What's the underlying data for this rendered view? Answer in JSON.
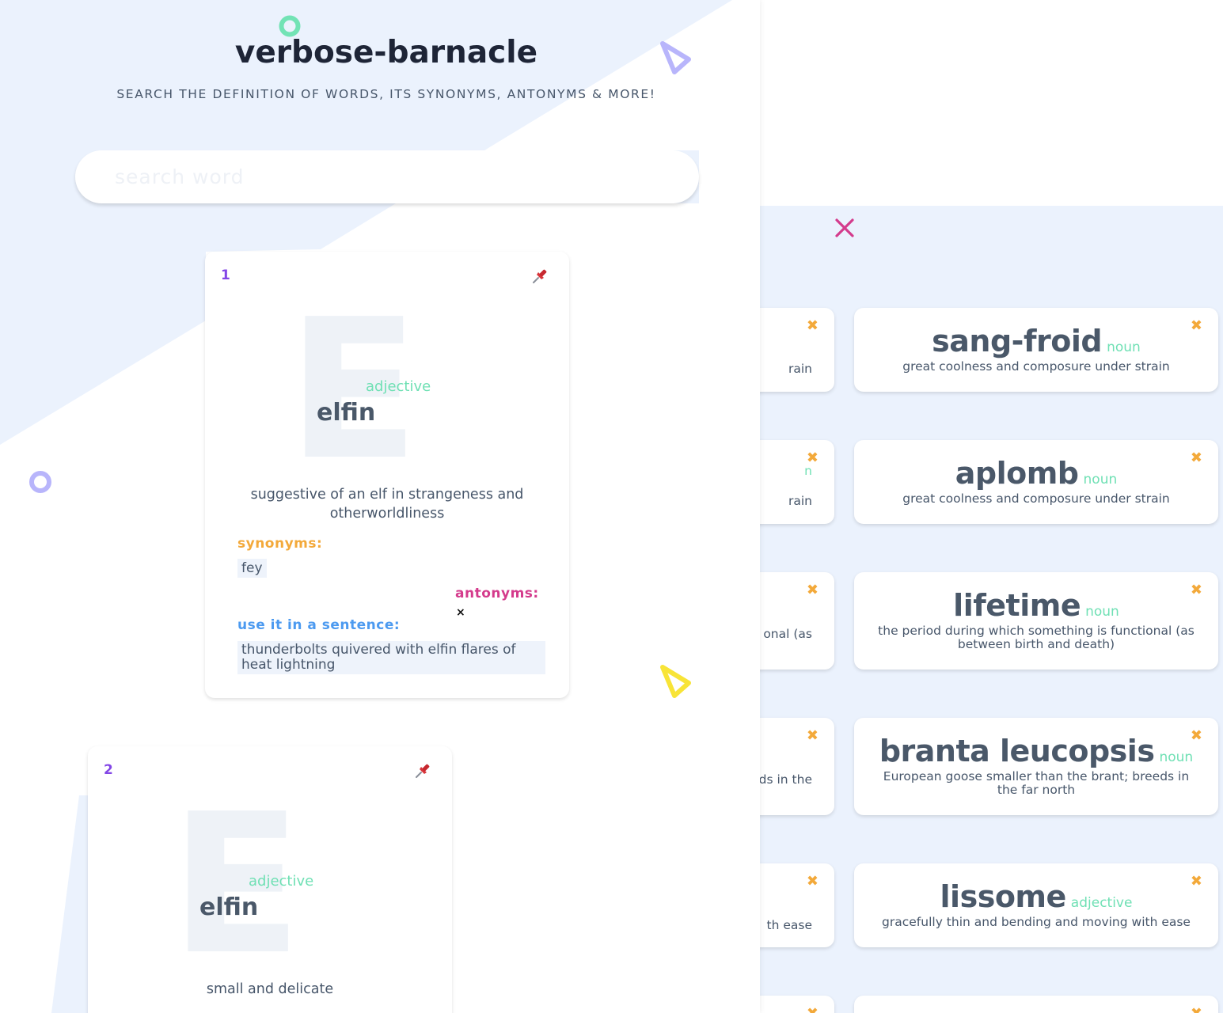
{
  "app": {
    "title": "verbose-barnacle",
    "subtitle": "SEARCH THE DEFINITION OF WORDS, ITS SYNONYMS, ANTONYMS & MORE!"
  },
  "search": {
    "placeholder": "search word",
    "value": ""
  },
  "colors": {
    "accent_purple": "#8346e6",
    "synonyms": "#f3a93a",
    "antonyms": "#d43b8c",
    "sentence": "#4c9af0",
    "part_of_speech": "#6fe0b4",
    "panel_bg": "#ebf2fd"
  },
  "labels": {
    "synonyms": "synonyms:",
    "antonyms": "antonyms:",
    "sentence": "use it in a sentence:"
  },
  "results": [
    {
      "index": "1",
      "letter": "E",
      "word": "elfin",
      "part_of_speech": "adjective",
      "definition": "suggestive of an elf in strangeness and otherworldliness",
      "synonyms": [
        "fey"
      ],
      "antonyms_empty_mark": "×",
      "sentence": "thunderbolts quivered with elfin flares of heat lightning"
    },
    {
      "index": "2",
      "letter": "E",
      "word": "elfin",
      "part_of_speech": "adjective",
      "definition": "small and delicate"
    }
  ],
  "saved": {
    "remove_icon": "x-icon",
    "close_icon": "close-icon",
    "pin_icon": "pushpin-icon",
    "cards": [
      {
        "word": "sang-froid",
        "part_of_speech": "noun",
        "definition": "great coolness and composure under strain"
      },
      {
        "word": "aplomb",
        "part_of_speech": "noun",
        "definition": "great coolness and composure under strain"
      },
      {
        "word": "lifetime",
        "part_of_speech": "noun",
        "definition": "the period during which something is functional (as between birth and death)"
      },
      {
        "word": "branta leucopsis",
        "part_of_speech": "noun",
        "definition": "European goose smaller than the brant; breeds in the far north"
      },
      {
        "word": "lissome",
        "part_of_speech": "adjective",
        "definition": "gracefully thin and bending and moving with ease"
      }
    ],
    "behind_fragments": [
      "rain",
      "n",
      "rain",
      "onal (as",
      "ds in the",
      "th ease"
    ]
  }
}
